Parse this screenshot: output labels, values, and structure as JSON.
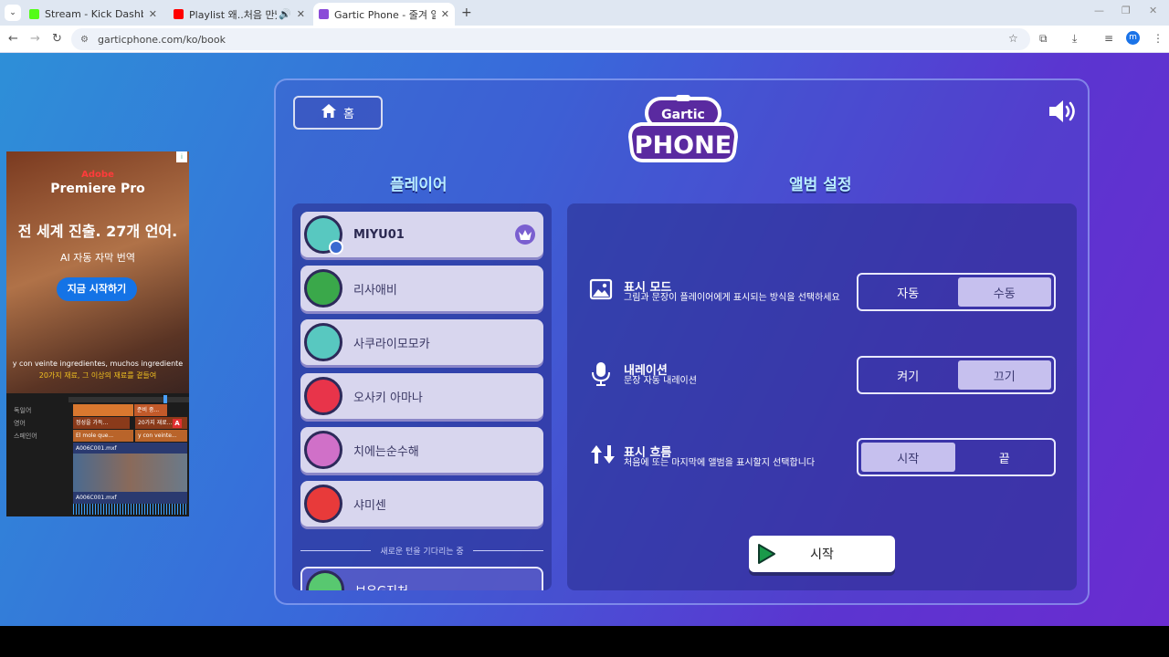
{
  "browser": {
    "tabs": [
      {
        "title": "Stream - Kick Dashboard",
        "favicon_color": "#53fc18"
      },
      {
        "title": "Playlist 왜..처음 만났을때",
        "favicon_color": "#ff0000"
      },
      {
        "title": "Gartic Phone - 줄겨 알하기",
        "favicon_color": "#8a4bd8"
      }
    ],
    "url": "garticphone.com/ko/book",
    "profile_initial": "m"
  },
  "ad": {
    "brand_top": "Adobe",
    "brand": "Premiere Pro",
    "headline": "전 세계 진출. 27개 언어.",
    "subline": "AI 자동 자막 번역",
    "cta": "지금 시작하기",
    "caption_es": "y con veinte ingredientes, muchos ingrediente",
    "caption_ko": "20가지 재료, 그 이상의 재료를 곁들여",
    "tracks": [
      "독일어",
      "영어",
      "스페인어"
    ],
    "clips": [
      "준비 중...",
      "정성을 가득...",
      "20가지 재료...",
      "El mole que...",
      "y con veinte...",
      "A006C001.mxf",
      "A006C001.mxf"
    ]
  },
  "game": {
    "home_label": "홈",
    "logo_top": "Gartic",
    "logo_bottom": "PHONE",
    "players_title": "플레이어",
    "settings_title": "앨범 설정",
    "players": [
      {
        "name": "MIYU01",
        "host": true,
        "avatar_color": "#58c8c0"
      },
      {
        "name": "리사애비",
        "host": false,
        "avatar_color": "#3aa84a"
      },
      {
        "name": "사쿠라이모모카",
        "host": false,
        "avatar_color": "#58c8c0"
      },
      {
        "name": "오사키 아마나",
        "host": false,
        "avatar_color": "#e8344a"
      },
      {
        "name": "치에는순수해",
        "host": false,
        "avatar_color": "#d070c8"
      },
      {
        "name": "샤미센",
        "host": false,
        "avatar_color": "#e83a3a"
      }
    ],
    "waiting_label": "새로운 턴을 기다리는 중",
    "waiting_player": "보우G지처",
    "settings": [
      {
        "title": "표시 모드",
        "desc": "그림과 문장이 플레이어에게 표시되는 방식을 선택하세요",
        "options": [
          "자동",
          "수동"
        ],
        "selected": 1
      },
      {
        "title": "내레이션",
        "desc": "문장 자동 내레이션",
        "options": [
          "켜기",
          "끄기"
        ],
        "selected": 1
      },
      {
        "title": "표시 흐름",
        "desc": "처음에 또는 마지막에 앨범을 표시할지 선택합니다",
        "options": [
          "시작",
          "끝"
        ],
        "selected": 0
      }
    ],
    "start_label": "시작"
  }
}
